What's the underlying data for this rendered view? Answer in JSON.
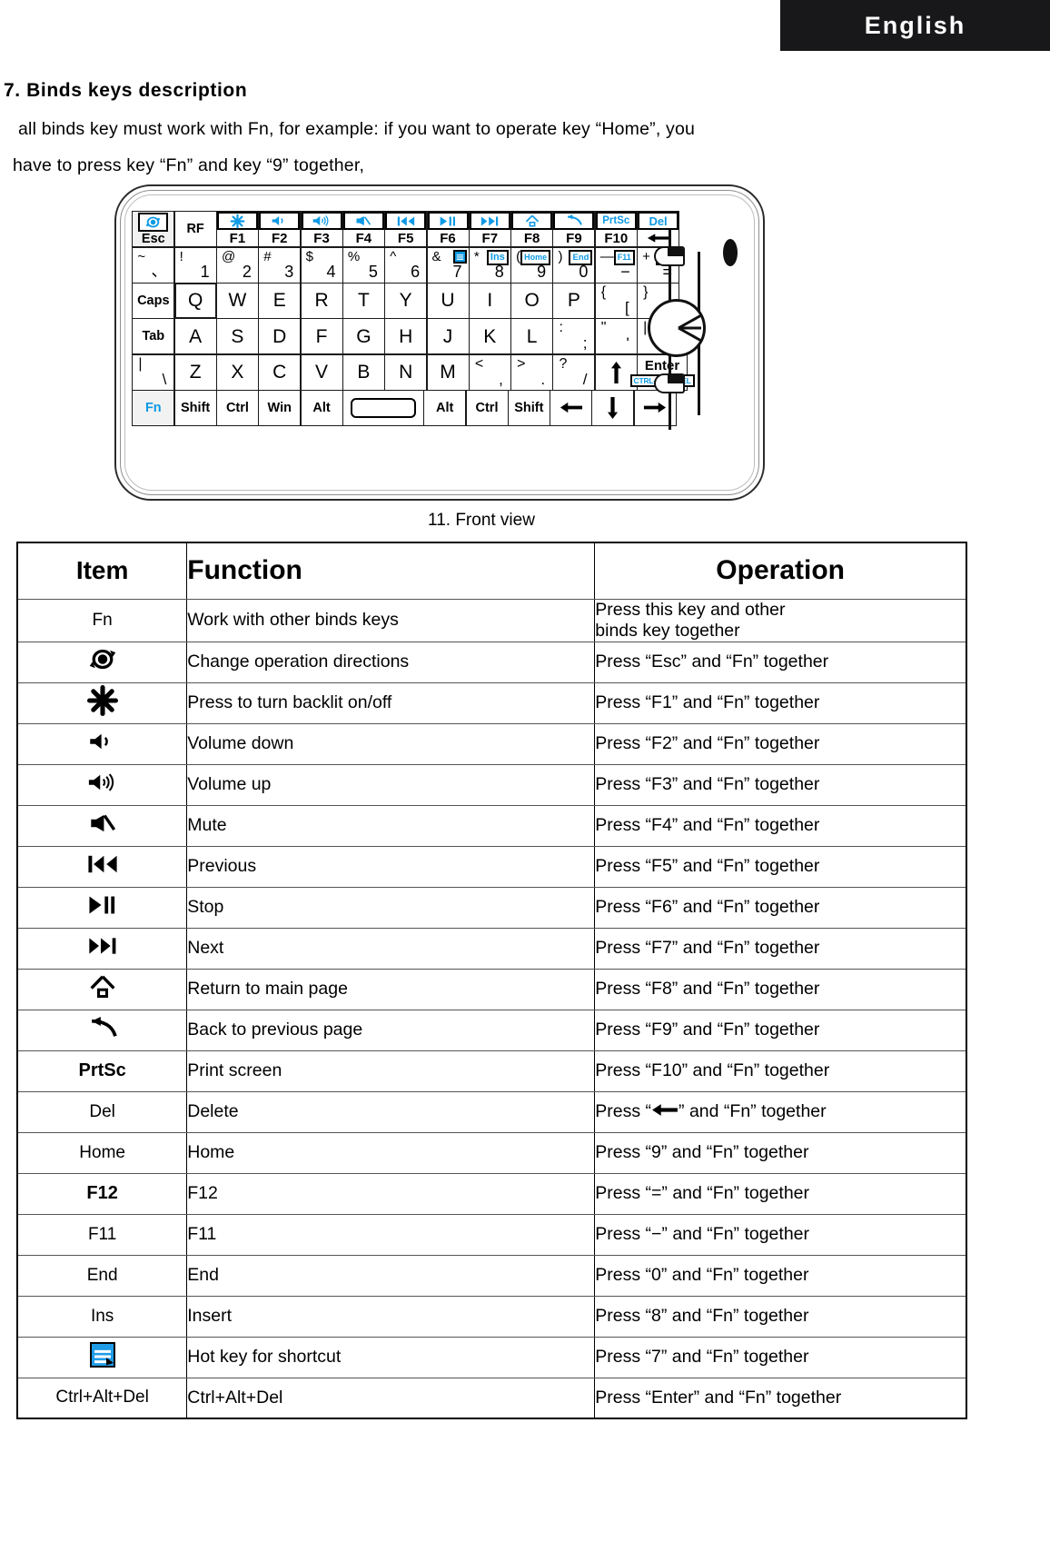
{
  "language_tab": {
    "label": "English"
  },
  "heading": {
    "number_title": "7. Binds keys description"
  },
  "intro": {
    "line1": "all binds key must work with Fn, for example: if you want to operate key “Home”, you",
    "line2": "have to press key “Fn” and key “9” together,"
  },
  "figure": {
    "caption": "11. Front view",
    "keyboard": {
      "row_fn": [
        {
          "name": "esc",
          "icon": "rotate-arrows-icon",
          "label": "Esc"
        },
        {
          "name": "rf",
          "label": "RF"
        },
        {
          "name": "f1",
          "icon": "backlight-star-icon",
          "label": "F1"
        },
        {
          "name": "f2",
          "icon": "volume-down-icon",
          "label": "F2"
        },
        {
          "name": "f3",
          "icon": "volume-up-icon",
          "label": "F3"
        },
        {
          "name": "f4",
          "icon": "mute-icon",
          "label": "F4"
        },
        {
          "name": "f5",
          "icon": "previous-track-icon",
          "label": "F5"
        },
        {
          "name": "f6",
          "icon": "play-pause-icon",
          "label": "F6"
        },
        {
          "name": "f7",
          "icon": "next-track-icon",
          "label": "F7"
        },
        {
          "name": "f8",
          "icon": "home-house-icon",
          "label": "F8"
        },
        {
          "name": "f9",
          "icon": "back-arrow-icon",
          "label": "F9"
        },
        {
          "name": "f10",
          "icon": "PrtSc",
          "label": "F10"
        },
        {
          "name": "backspace",
          "icon": "Del",
          "label": "arrow-left-icon"
        }
      ],
      "row_num": [
        {
          "upper": "~",
          "lower": "、"
        },
        {
          "upper": "!",
          "lower": "1"
        },
        {
          "upper": "@",
          "lower": "2"
        },
        {
          "upper": "#",
          "lower": "3"
        },
        {
          "upper": "$",
          "lower": "4"
        },
        {
          "upper": "%",
          "lower": "5"
        },
        {
          "upper": "^",
          "lower": "6"
        },
        {
          "upper": "&",
          "lower": "7",
          "tag": "menu-icon"
        },
        {
          "upper": "*",
          "lower": "8",
          "tag": "Ins"
        },
        {
          "upper": "(",
          "lower": "9",
          "tag": "Home"
        },
        {
          "upper": ")",
          "lower": "0",
          "tag": "End"
        },
        {
          "upper": "—",
          "lower": "−",
          "tag": "F11"
        },
        {
          "upper": "+",
          "lower": "=",
          "tag": "F12"
        }
      ],
      "row_q": [
        "Caps",
        "Q",
        "W",
        "E",
        "R",
        "T",
        "Y",
        "U",
        "I",
        "O",
        "P",
        "{ [",
        "} ]"
      ],
      "row_a": [
        "Tab",
        "A",
        "S",
        "D",
        "F",
        "G",
        "H",
        "J",
        "K",
        "L",
        ": ;",
        "\" ,",
        "| \\"
      ],
      "row_z": [
        "| \\",
        "Z",
        "X",
        "C",
        "V",
        "B",
        "N",
        "M",
        "< ,",
        "> .",
        "? /",
        "arrow-up-icon",
        "Enter"
      ],
      "row_z_enter_sub": "CTRL+ALT+DEL",
      "row_bottom": [
        "Fn",
        "Shift",
        "Ctrl",
        "Win",
        "Alt",
        "space",
        "Alt",
        "Ctrl",
        "Shift",
        "arrow-left-icon",
        "arrow-down-icon",
        "arrow-right-icon"
      ]
    }
  },
  "table": {
    "headers": {
      "item": "Item",
      "function": "Function",
      "operation": "Operation"
    },
    "rows": [
      {
        "item": "Fn",
        "item_type": "text",
        "function": "Work with other binds keys",
        "operation": "Press this key and other",
        "operation_line2": "binds key together"
      },
      {
        "item": "rotate-arrows-icon",
        "item_type": "icon",
        "function": "Change operation directions",
        "operation": "Press “Esc” and “Fn” together"
      },
      {
        "item": "backlight-star-icon",
        "item_type": "icon",
        "function": "Press to turn backlit on/off",
        "operation": "Press “F1” and “Fn” together"
      },
      {
        "item": "volume-down-icon",
        "item_type": "icon",
        "function": "Volume down",
        "operation": "Press “F2” and “Fn” together"
      },
      {
        "item": "volume-up-icon",
        "item_type": "icon",
        "function": "Volume up",
        "operation": "Press “F3” and “Fn” together"
      },
      {
        "item": "mute-icon",
        "item_type": "icon",
        "function": "Mute",
        "operation": "Press “F4” and “Fn” together"
      },
      {
        "item": "previous-track-icon",
        "item_type": "icon",
        "function": "Previous",
        "operation": "Press “F5” and “Fn” together"
      },
      {
        "item": "play-pause-icon",
        "item_type": "icon",
        "function": "Stop",
        "operation": "Press “F6” and “Fn” together"
      },
      {
        "item": "next-track-icon",
        "item_type": "icon",
        "function": "Next",
        "operation": "Press “F7” and “Fn” together"
      },
      {
        "item": "home-house-icon",
        "item_type": "icon",
        "function": "Return to main page",
        "operation": "Press “F8” and “Fn” together"
      },
      {
        "item": "back-arrow-icon",
        "item_type": "icon",
        "function": "Back to previous page",
        "operation": "Press “F9” and “Fn” together"
      },
      {
        "item": "PrtSc",
        "item_type": "text_bold",
        "function": "Print screen",
        "operation": "Press “F10” and “Fn” together"
      },
      {
        "item": "Del",
        "item_type": "text",
        "function": "Delete",
        "operation_pre": "Press “",
        "operation_icon": "arrow-left-icon",
        "operation_post": "” and “Fn” together"
      },
      {
        "item": "Home",
        "item_type": "text",
        "function": "Home",
        "operation": "Press “9” and “Fn” together"
      },
      {
        "item": "F12",
        "item_type": "text_bold",
        "function": "F12",
        "operation": "Press “=” and “Fn” together"
      },
      {
        "item": "F11",
        "item_type": "text",
        "function": "F11",
        "operation": "Press “−” and “Fn” together"
      },
      {
        "item": "End",
        "item_type": "text",
        "function": "End",
        "operation": "Press “0” and “Fn” together"
      },
      {
        "item": "Ins",
        "item_type": "text",
        "function": "Insert",
        "operation": "Press “8” and “Fn” together"
      },
      {
        "item": "menu-icon",
        "item_type": "icon",
        "function": "Hot key for shortcut",
        "operation": "Press “7” and “Fn” together"
      },
      {
        "item": "Ctrl+Alt+Del",
        "item_type": "text",
        "function": "Ctrl+Alt+Del",
        "operation": "Press “Enter” and “Fn” together"
      }
    ]
  },
  "colors": {
    "accent_blue": "#0d9ae5",
    "tab_background": "#18181a",
    "ink": "#000000"
  }
}
